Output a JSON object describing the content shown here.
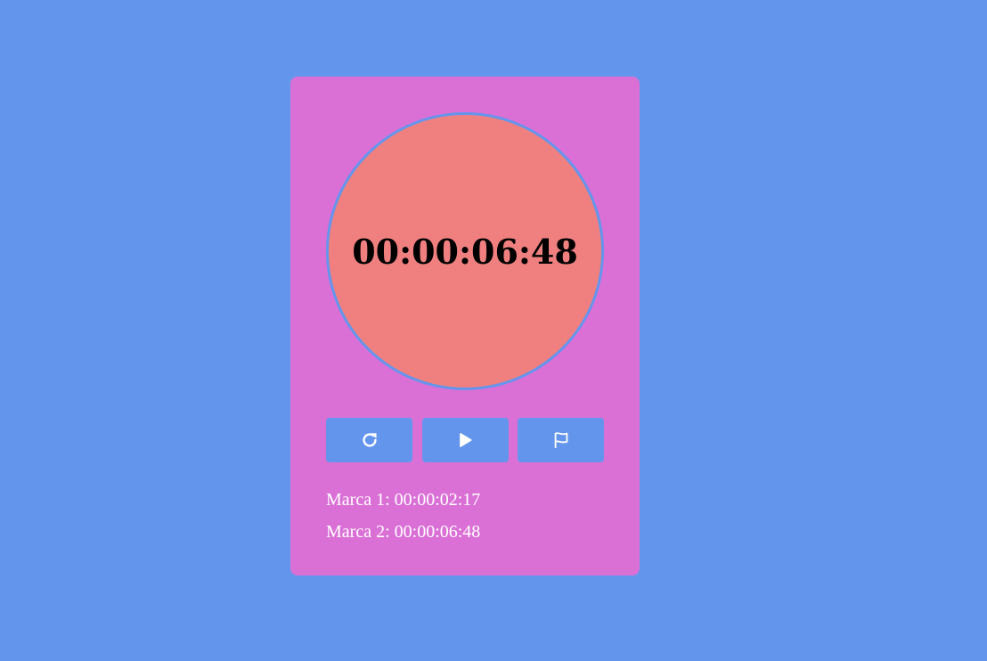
{
  "colors": {
    "page_background": "#6495ED",
    "card_background": "#DA70D6",
    "dial_fill": "#F08080",
    "dial_border": "#6495ED",
    "button_background": "#6495ED",
    "icon_color": "#FFFFFF",
    "lap_text": "#FFFFFF",
    "time_text": "#000000"
  },
  "stopwatch": {
    "display": "00:00:06:48"
  },
  "controls": [
    {
      "name": "reset-button",
      "icon": "reset-icon"
    },
    {
      "name": "play-button",
      "icon": "play-icon"
    },
    {
      "name": "lap-button",
      "icon": "flag-icon"
    }
  ],
  "laps": [
    {
      "text": "Marca 1: 00:00:02:17"
    },
    {
      "text": "Marca 2: 00:00:06:48"
    }
  ]
}
